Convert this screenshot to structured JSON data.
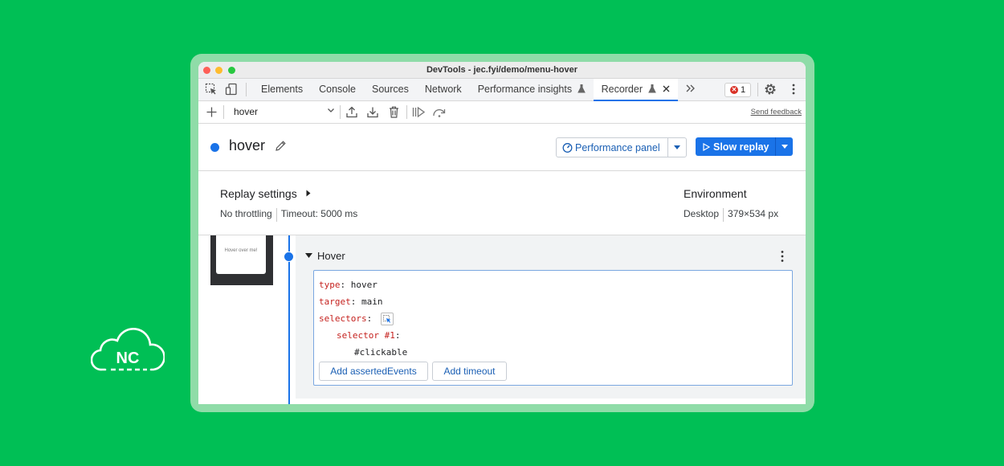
{
  "window": {
    "title": "DevTools - jec.fyi/demo/menu-hover"
  },
  "tabs": [
    {
      "label": "Elements"
    },
    {
      "label": "Console"
    },
    {
      "label": "Sources"
    },
    {
      "label": "Network"
    },
    {
      "label": "Performance insights"
    },
    {
      "label": "Recorder"
    }
  ],
  "error_badge": {
    "count": "1"
  },
  "toolbar": {
    "recording_select": "hover",
    "send_feedback": "Send feedback"
  },
  "recording": {
    "title": "hover",
    "performance_panel_label": "Performance panel",
    "slow_replay_label": "Slow replay"
  },
  "replay_settings": {
    "title": "Replay settings",
    "throttling": "No throttling",
    "timeout": "Timeout: 5000 ms"
  },
  "environment": {
    "title": "Environment",
    "device": "Desktop",
    "size": "379×534 px"
  },
  "thumbnail": {
    "text": "Hover over me!"
  },
  "step": {
    "title": "Hover",
    "type_key": "type",
    "type_value": "hover",
    "target_key": "target",
    "target_value": "main",
    "selectors_key": "selectors",
    "selector1_key": "selector #1",
    "selector1_value": "#clickable",
    "add_asserted_events": "Add assertedEvents",
    "add_timeout": "Add timeout"
  },
  "logo": {
    "text": "NC"
  },
  "colors": {
    "background": "#00bf55",
    "accent": "#1a73e8",
    "code_key": "#c5221f"
  }
}
